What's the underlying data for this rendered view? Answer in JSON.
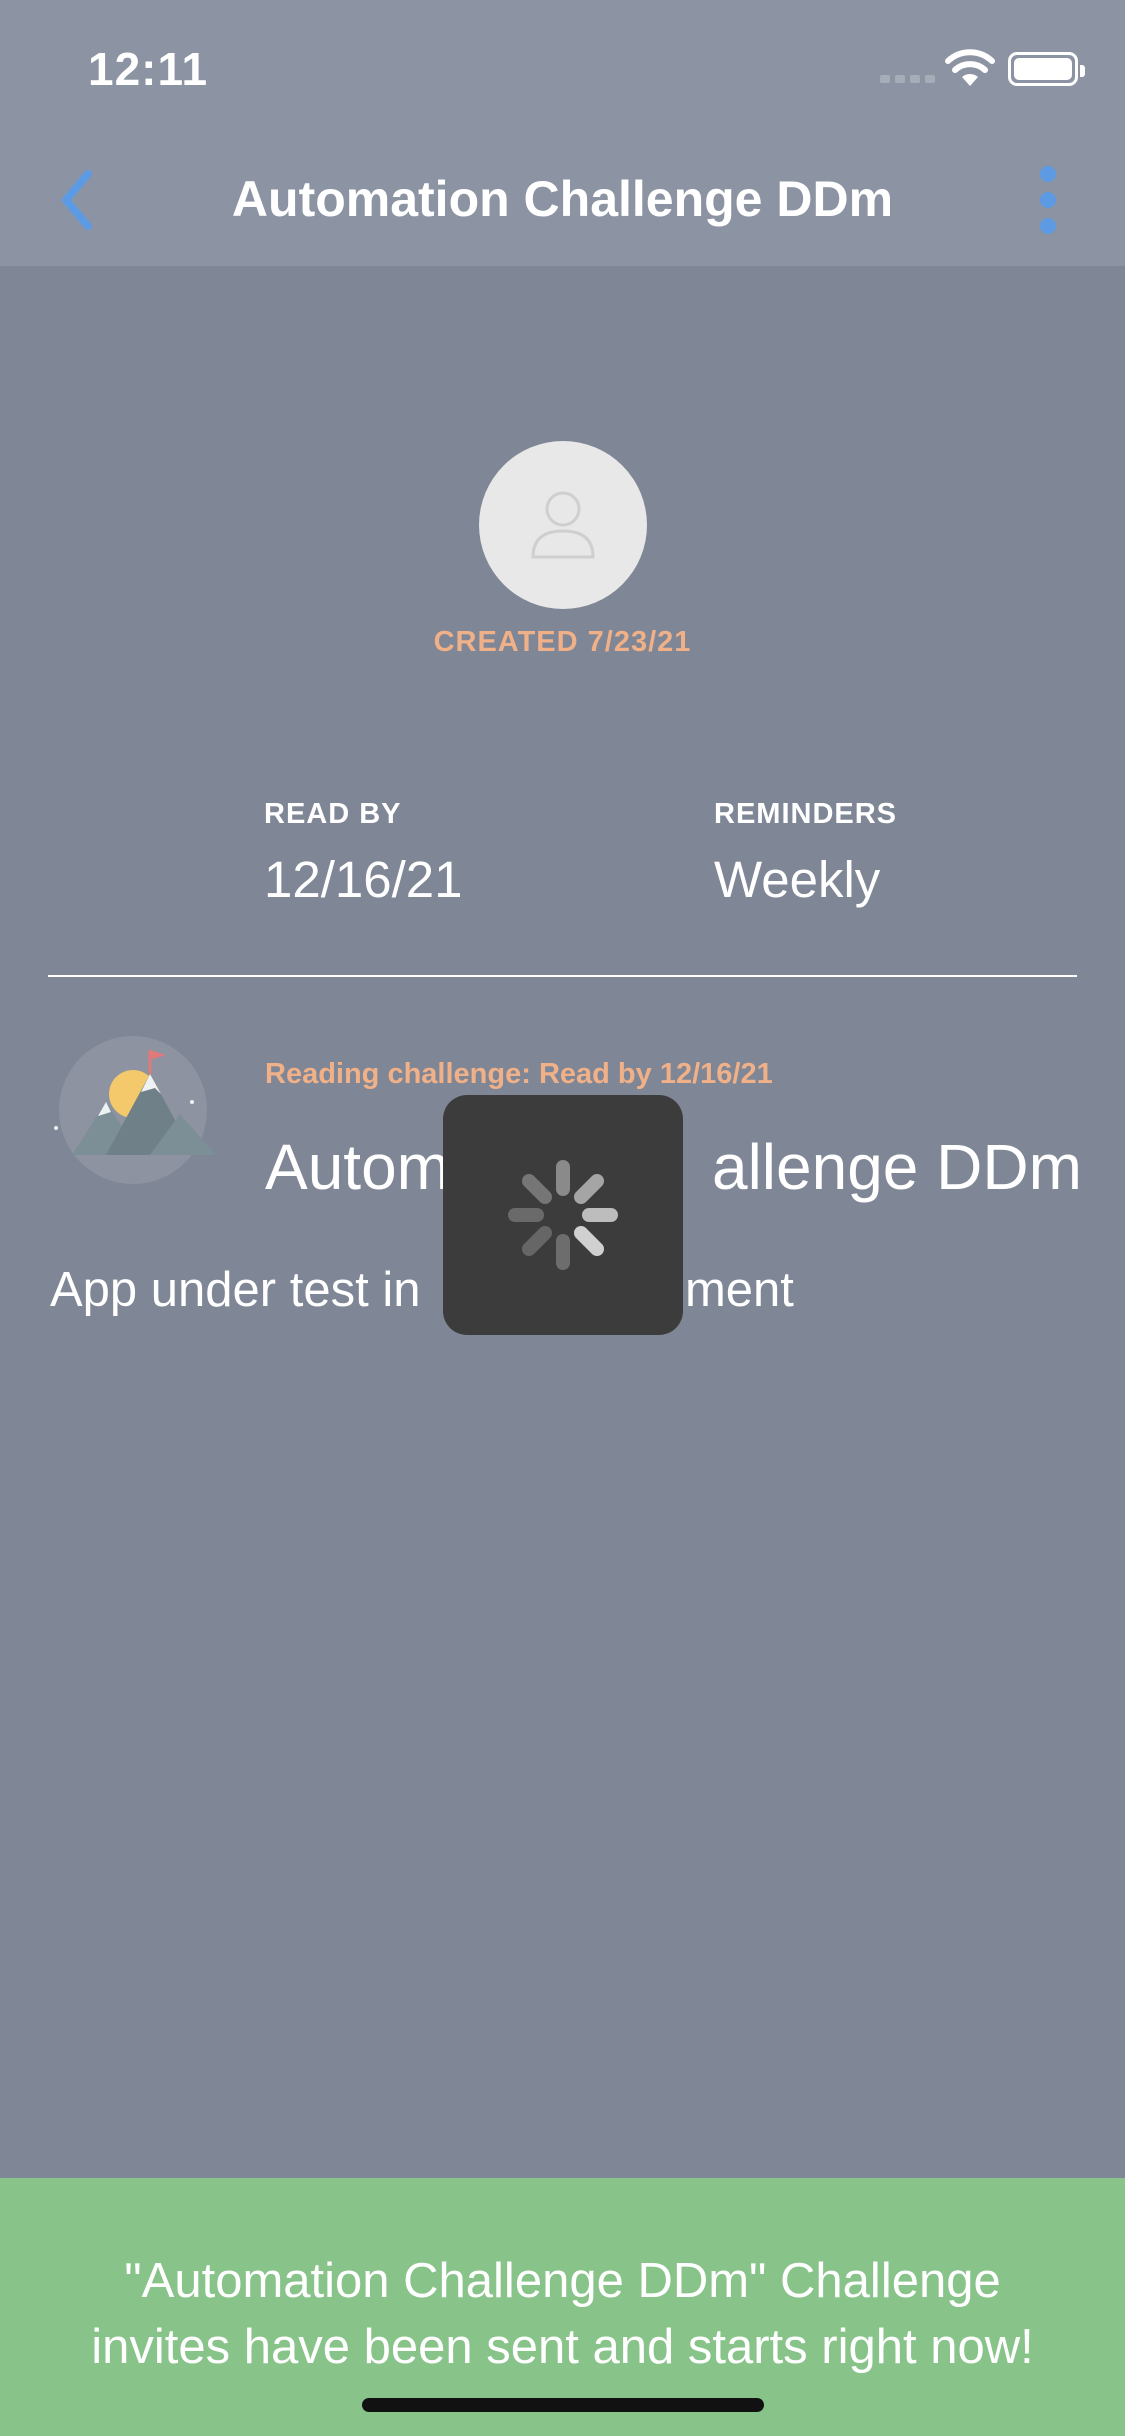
{
  "status_bar": {
    "time": "12:11"
  },
  "nav": {
    "title": "Automation Challenge DDm",
    "accent": "#5c9be3"
  },
  "profile": {
    "created": "CREATED 7/23/21"
  },
  "stats": {
    "read_by_label": "READ BY",
    "read_by_value": "12/16/21",
    "reminders_label": "REMINDERS",
    "reminders_value": "Weekly"
  },
  "challenge": {
    "subtitle": "Reading challenge: Read by 12/16/21",
    "title_left": "Autom",
    "title_right": "allenge DDm",
    "desc_left": "App under test in",
    "desc_right": "onment"
  },
  "toast": {
    "line1": "\"Automation Challenge DDm\" Challenge",
    "line2": "invites have been sent and starts right now!",
    "color": "#88c48a"
  }
}
